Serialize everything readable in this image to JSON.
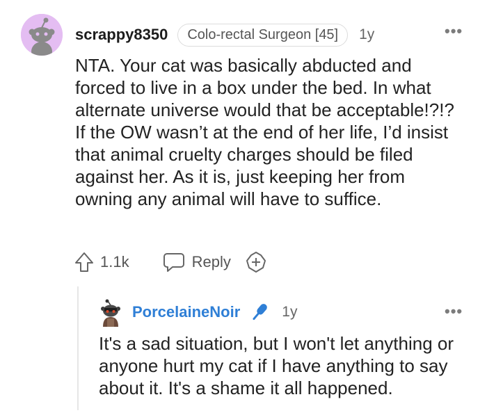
{
  "comment": {
    "username": "scrappy8350",
    "flair": "Colo-rectal Surgeon [45]",
    "age": "1y",
    "text": "NTA. Your cat was basically abducted and forced to live in a box under the bed. In what alternate universe would that be acceptable!?!? If the OW wasn’t at the end of her life, I’d insist that animal cruelty charges should be filed against her. As it is, just keeping her from owning any animal will have to suffice.",
    "avatar_color": "#e4bdf2",
    "actions": {
      "upvotes": "1.1k",
      "reply_label": "Reply"
    }
  },
  "reply": {
    "username": "PorcelaineNoir",
    "username_color": "#2f7fd6",
    "age": "1y",
    "text": "It's a sad situation, but I won't let anything or anyone hurt my cat if I have anything to say about it. It's a shame it all happened."
  },
  "icons": {
    "more": "more-options-icon",
    "upvote": "upvote-arrow-icon",
    "reply": "speech-bubble-icon",
    "award": "award-plus-icon",
    "mod": "microphone-icon"
  }
}
